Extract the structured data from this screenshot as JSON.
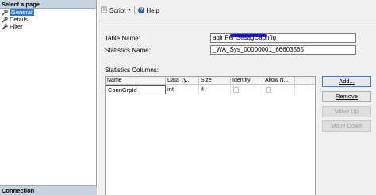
{
  "left": {
    "select_page_label": "Select a page",
    "pages": [
      {
        "label": "General",
        "selected": true
      },
      {
        "label": "Details",
        "selected": false
      },
      {
        "label": "Filter",
        "selected": false
      }
    ],
    "connection_label": "Connection"
  },
  "toolbar": {
    "script_label": "Script",
    "help_label": "Help"
  },
  "form": {
    "table_name_label": "Table Name:",
    "table_name_value": "aqlrtFer  SesagCaonfig",
    "statistics_name_label": "Statistics Name:",
    "statistics_name_value": "_WA_Sys_00000001_66603565",
    "statistics_columns_label": "Statistics Columns:"
  },
  "grid": {
    "columns": [
      "Name",
      "Data Ty...",
      "Size",
      "Identity",
      "Allow N..."
    ],
    "rows": [
      {
        "name": "ConnGrpId",
        "data_type": "int",
        "size": "4",
        "identity": false,
        "allow_nulls": false
      }
    ]
  },
  "buttons": {
    "add": "Add...",
    "remove": "Remove",
    "move_up": "Move Up",
    "move_down": "Move Down"
  },
  "colors": {
    "selected_page": "#3178c6",
    "header_band": "#c7d2df",
    "redaction_scribble": "#1212d8"
  },
  "icons": [
    "wrench-icon",
    "script-icon",
    "help-icon",
    "dropdown-caret-icon"
  ]
}
